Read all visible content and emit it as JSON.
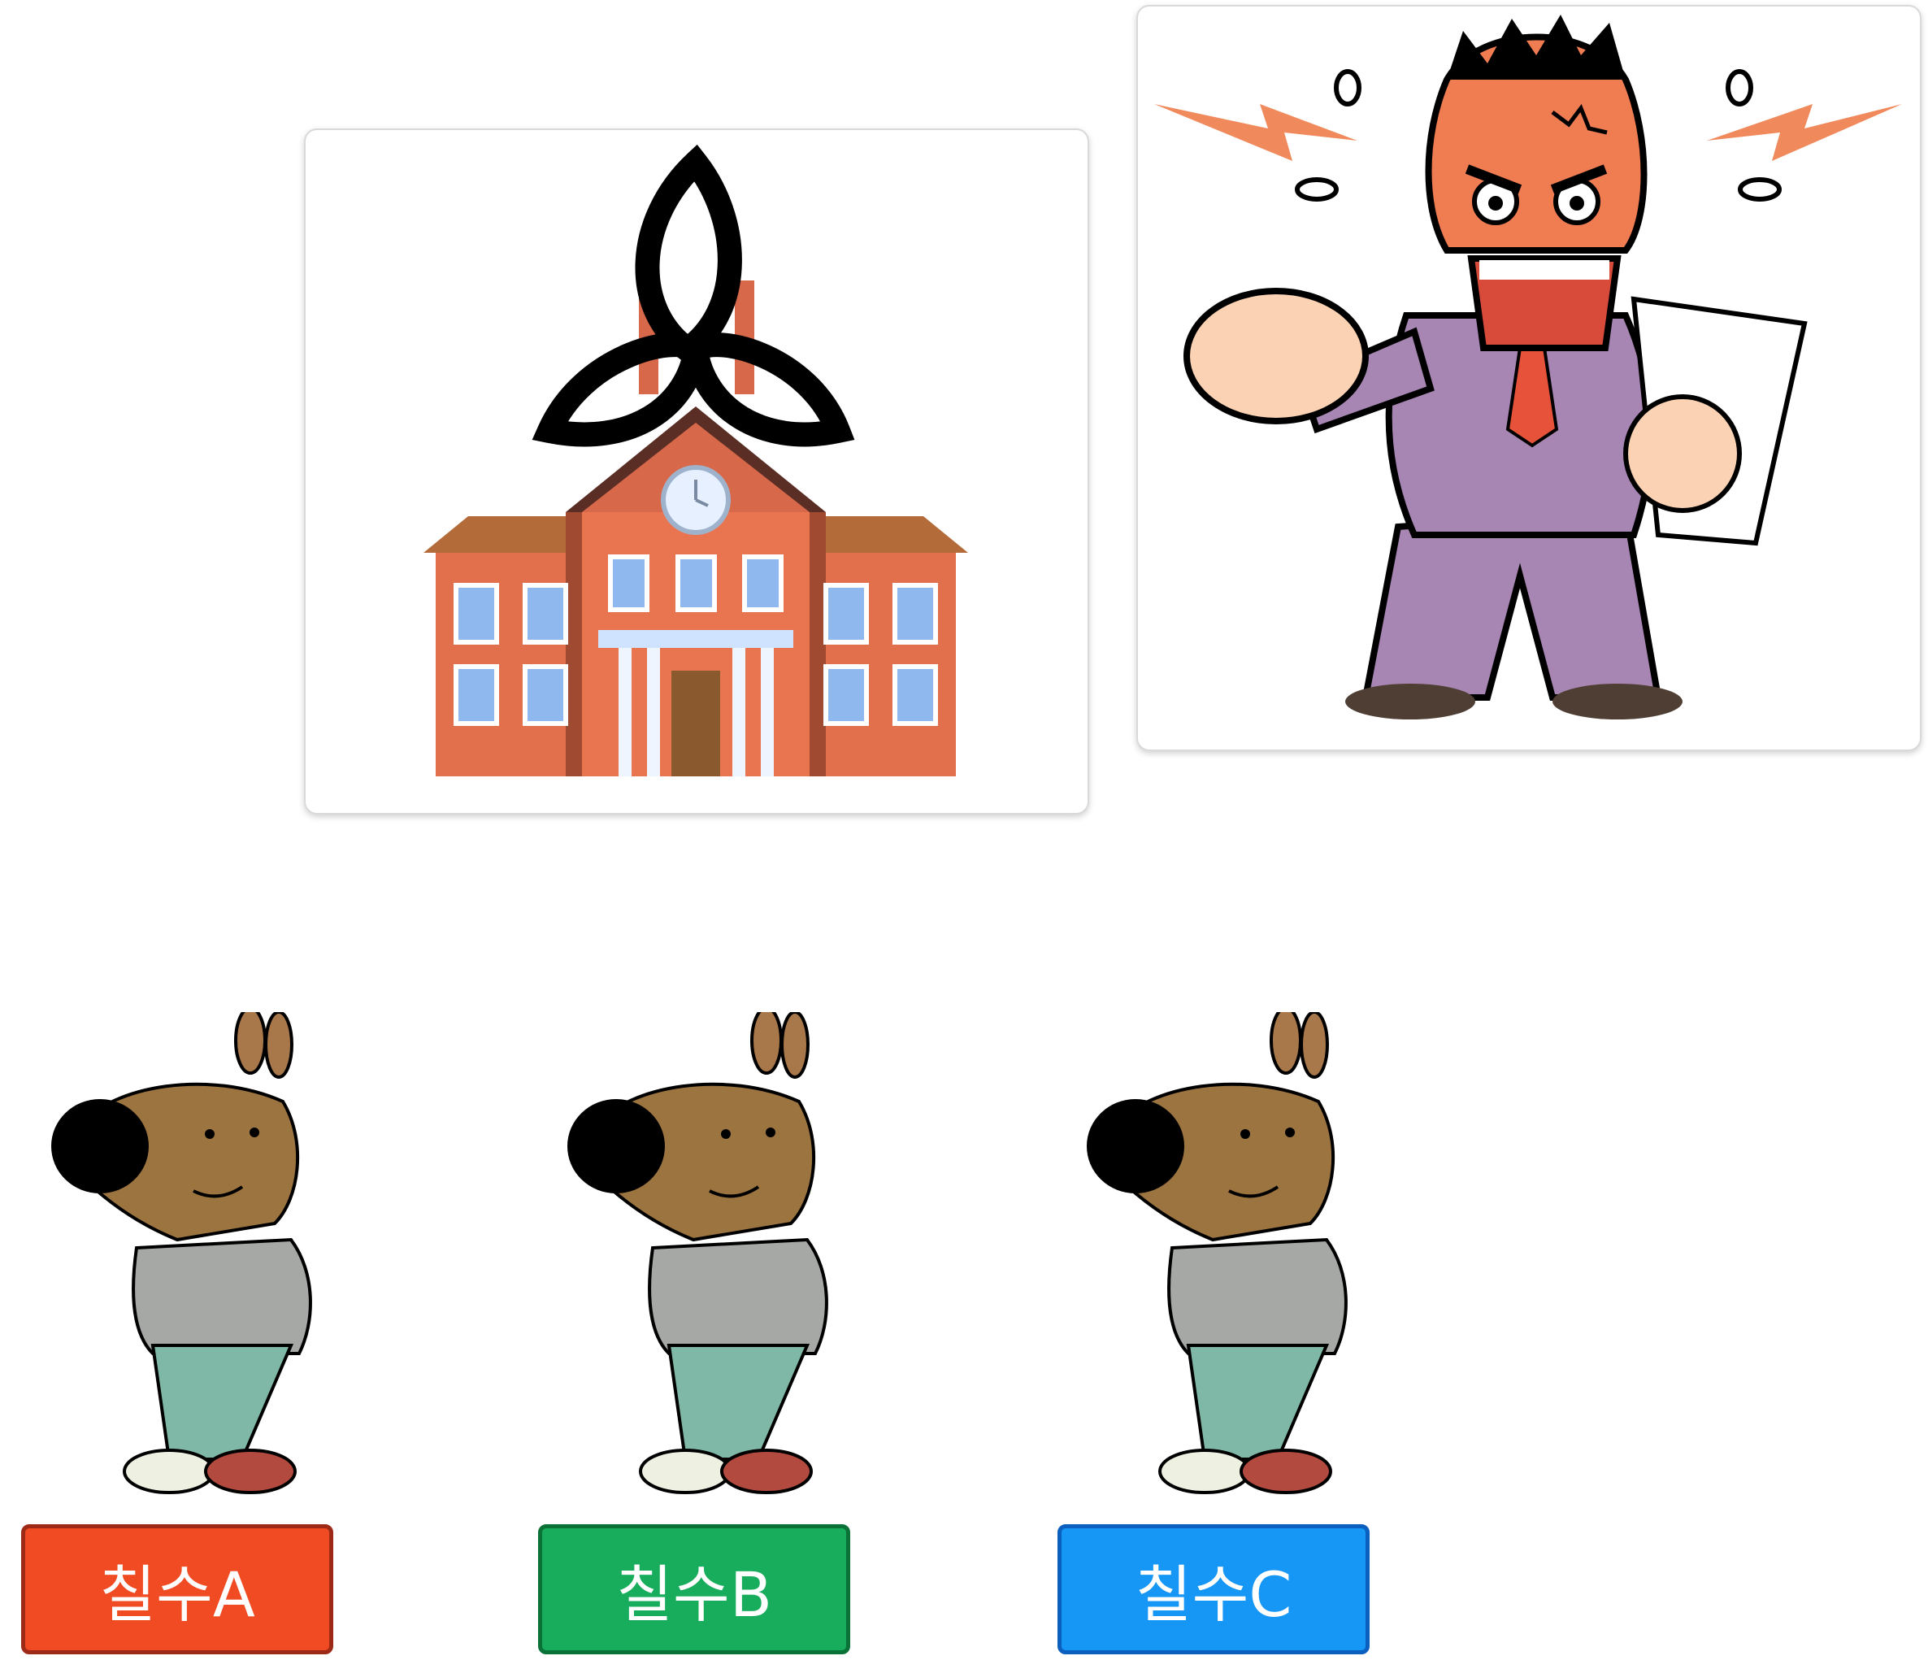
{
  "cards": {
    "school": {
      "icon": "school-building-with-triquetra-icon"
    },
    "boss": {
      "icon": "angry-boss-pointing-icon"
    }
  },
  "characters": [
    {
      "icon": "dog-character-icon"
    },
    {
      "icon": "dog-character-icon"
    },
    {
      "icon": "dog-character-icon"
    }
  ],
  "buttons": [
    {
      "label": "칠수A",
      "color": "#f04b22",
      "border": "#9c2a17"
    },
    {
      "label": "칠수B",
      "color": "#17ad5c",
      "border": "#0b7237"
    },
    {
      "label": "칠수C",
      "color": "#1697f5",
      "border": "#0a5fbf"
    }
  ]
}
